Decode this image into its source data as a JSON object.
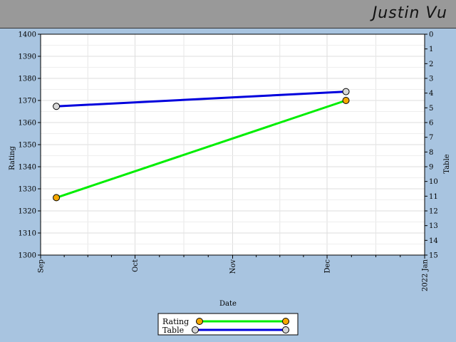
{
  "header": {
    "player_name": "Justin Vu"
  },
  "chart_data": {
    "type": "line",
    "xlabel": "Date",
    "ylabel": "Rating",
    "y2label": "Table",
    "x_ticks": [
      {
        "label": "Sep",
        "date": "2021-09-01"
      },
      {
        "label": "Oct",
        "date": "2021-10-01"
      },
      {
        "label": "Nov",
        "date": "2021-11-01"
      },
      {
        "label": "Dec",
        "date": "2021-12-01"
      },
      {
        "label": "2022 Jan",
        "date": "2022-01-01"
      }
    ],
    "xlim": [
      "2021-09-01",
      "2022-01-01"
    ],
    "ylim": [
      1300,
      1400
    ],
    "y_ticks": [
      1300,
      1310,
      1320,
      1330,
      1340,
      1350,
      1360,
      1370,
      1380,
      1390,
      1400
    ],
    "y2lim": [
      15,
      0
    ],
    "y2_ticks": [
      0,
      1,
      2,
      3,
      4,
      5,
      6,
      7,
      8,
      9,
      10,
      11,
      12,
      13,
      14,
      15
    ],
    "grid": true,
    "legend_position": "bottom-center",
    "series": [
      {
        "name": "Rating",
        "axis": "left",
        "color": "#00ee00",
        "marker_color": "#f5a800",
        "points": [
          {
            "x": "2021-09-06",
            "y": 1326
          },
          {
            "x": "2021-12-07",
            "y": 1370
          }
        ]
      },
      {
        "name": "Table",
        "axis": "right",
        "color": "#0000dd",
        "marker_color": "#d8d8d8",
        "points": [
          {
            "x": "2021-09-06",
            "y": 4.9
          },
          {
            "x": "2021-12-07",
            "y": 3.9
          }
        ]
      }
    ]
  }
}
